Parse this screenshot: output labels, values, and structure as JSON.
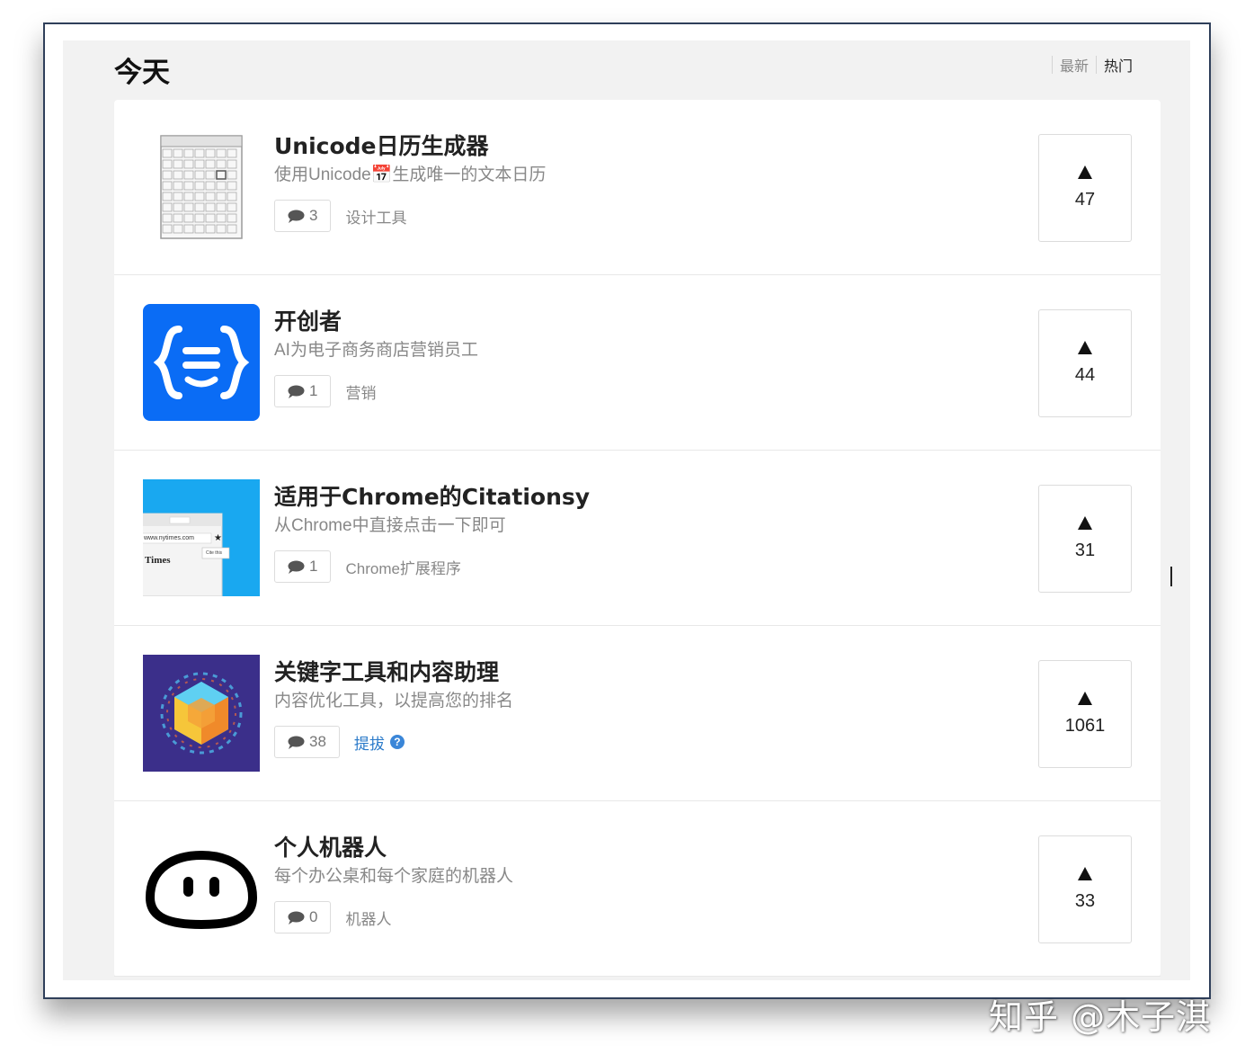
{
  "header": {
    "title": "今天",
    "sort_tabs": [
      {
        "label": "最新",
        "active": false
      },
      {
        "label": "热门",
        "active": true
      }
    ]
  },
  "products": [
    {
      "title": "Unicode日历生成器",
      "tagline": "使用Unicode📅生成唯一的文本日历",
      "comments": "3",
      "tag": "设计工具",
      "votes": "47",
      "thumbnail": "calendar-thumbnail"
    },
    {
      "title": "开创者",
      "tagline": "AI为电子商务商店营销员工",
      "comments": "1",
      "tag": "营销",
      "votes": "44",
      "thumbnail": "curly-braces-logo"
    },
    {
      "title": "适用于Chrome的Citationsy",
      "tagline": "从Chrome中直接点击一下即可",
      "comments": "1",
      "tag": "Chrome扩展程序",
      "votes": "31",
      "thumbnail": "browser-screenshot-thumbnail",
      "thumb_text": {
        "url": "www.nytimes.com",
        "site": "Times",
        "button": "Cite this"
      }
    },
    {
      "title": "关键字工具和内容助理",
      "tagline": "内容优化工具，以提高您的排名",
      "comments": "38",
      "tag": "提拔",
      "tag_help": "?",
      "votes": "1061",
      "thumbnail": "hex-cube-logo"
    },
    {
      "title": "个人机器人",
      "tagline": "每个办公桌和每个家庭的机器人",
      "comments": "0",
      "tag": "机器人",
      "votes": "33",
      "thumbnail": "robot-face-logo"
    }
  ],
  "watermark": "知乎 @木子淇",
  "colors": {
    "accent_blue": "#0a6cf5",
    "promo_link": "#2a7ac9",
    "page_bg": "#f2f2f2"
  }
}
